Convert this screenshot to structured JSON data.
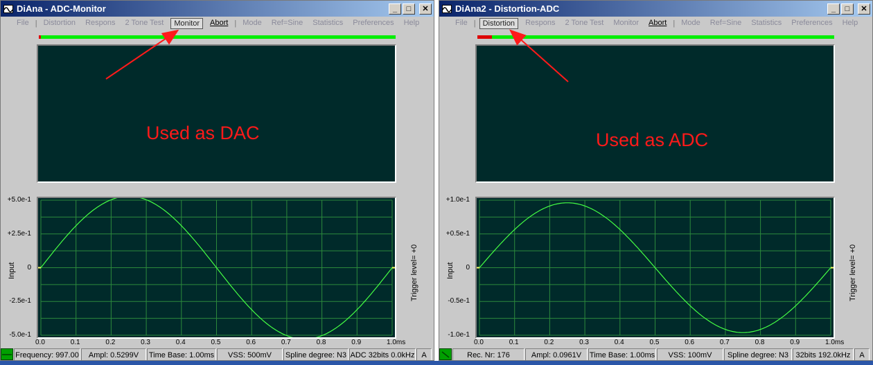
{
  "colors": {
    "title_bar": "#0a246a",
    "graph_background": "#002a2a",
    "grid": "#2c8a3c",
    "trace": "#44ff44",
    "annotation": "#ff1a1a",
    "progress": "#00ee00"
  },
  "windows": [
    {
      "id": "w1",
      "title": "DiAna - ADC-Monitor",
      "buttons": {
        "minimize": "_",
        "maximize": "□",
        "close": "✕"
      },
      "menu": {
        "file": "File",
        "distortion": "Distortion",
        "respons": "Respons",
        "two_tone": "2 Tone Test",
        "monitor": "Monitor",
        "abort": "Abort",
        "mode": "Mode",
        "ref": "Ref=Sine",
        "statistics": "Statistics",
        "preferences": "Preferences",
        "help": "Help",
        "active": "monitor"
      },
      "progress_fraction": 0.006,
      "annotation": "Used as DAC",
      "chart": {
        "y_ticks": [
          "+5.0e-1",
          "+2.5e-1",
          "0",
          "-2.5e-1",
          "-5.0e-1"
        ],
        "x_ticks": [
          "0.0",
          "0.1",
          "0.2",
          "0.3",
          "0.4",
          "0.5",
          "0.6",
          "0.7",
          "0.8",
          "0.9",
          "1.0ms"
        ],
        "ylabel": "Input",
        "trigger": "Trigger level=  +0"
      },
      "status": {
        "icon": "status-led-icon",
        "cells": [
          "Frequency: 997.00",
          "Ampl: 0.5299V",
          "Time Base: 1.00ms",
          "VSS: 500mV",
          "Spline degree: N3",
          "ADC 32bits 0.0kHz",
          "A"
        ]
      }
    },
    {
      "id": "w2",
      "title": "DiAna2 - Distortion-ADC",
      "buttons": {
        "minimize": "_",
        "maximize": "□",
        "close": "✕"
      },
      "menu": {
        "file": "File",
        "distortion": "Distortion",
        "respons": "Respons",
        "two_tone": "2 Tone Test",
        "monitor": "Monitor",
        "abort": "Abort",
        "mode": "Mode",
        "ref": "Ref=Sine",
        "statistics": "Statistics",
        "preferences": "Preferences",
        "help": "Help",
        "active": "distortion"
      },
      "progress_fraction": 0.04,
      "annotation": "Used as ADC",
      "chart": {
        "y_ticks": [
          "+1.0e-1",
          "+0.5e-1",
          "0",
          "-0.5e-1",
          "-1.0e-1"
        ],
        "x_ticks": [
          "0.0",
          "0.1",
          "0.2",
          "0.3",
          "0.4",
          "0.5",
          "0.6",
          "0.7",
          "0.8",
          "0.9",
          "1.0ms"
        ],
        "ylabel": "Input",
        "trigger": "Trigger level=  +0"
      },
      "status": {
        "icon": "status-led-icon",
        "cells": [
          "Rec. Nr: 176",
          "Ampl: 0.0961V",
          "Time Base: 1.00ms",
          "VSS: 100mV",
          "Spline degree: N3",
          "32bits 192.0kHz",
          "A"
        ]
      }
    }
  ],
  "chart_data": [
    {
      "type": "line",
      "title": "",
      "xlabel": "",
      "ylabel": "Input",
      "xlim": [
        0,
        1.0
      ],
      "ylim": [
        -0.5,
        0.5
      ],
      "x_unit": "ms",
      "grid": true,
      "series": [
        {
          "x": [
            0,
            0.05,
            0.1,
            0.15,
            0.2,
            0.25,
            0.3,
            0.35,
            0.4,
            0.45,
            0.5,
            0.55,
            0.6,
            0.65,
            0.7,
            0.75,
            0.8,
            0.85,
            0.9,
            0.95,
            1.0
          ],
          "values": [
            0,
            0.164,
            0.311,
            0.428,
            0.503,
            0.529,
            0.503,
            0.428,
            0.311,
            0.164,
            0,
            -0.164,
            -0.311,
            -0.428,
            -0.503,
            -0.529,
            -0.503,
            -0.428,
            -0.311,
            -0.164,
            0
          ]
        }
      ]
    },
    {
      "type": "line",
      "title": "",
      "xlabel": "",
      "ylabel": "Input",
      "xlim": [
        0,
        1.0
      ],
      "ylim": [
        -0.1,
        0.1
      ],
      "x_unit": "ms",
      "grid": true,
      "series": [
        {
          "x": [
            0,
            0.05,
            0.1,
            0.15,
            0.2,
            0.25,
            0.3,
            0.35,
            0.4,
            0.45,
            0.5,
            0.55,
            0.6,
            0.65,
            0.7,
            0.75,
            0.8,
            0.85,
            0.9,
            0.95,
            1.0
          ],
          "values": [
            0,
            0.0297,
            0.0565,
            0.0777,
            0.0914,
            0.0961,
            0.0914,
            0.0777,
            0.0565,
            0.0297,
            0,
            -0.0297,
            -0.0565,
            -0.0777,
            -0.0914,
            -0.0961,
            -0.0914,
            -0.0777,
            -0.0565,
            -0.0297,
            0
          ]
        }
      ]
    }
  ]
}
